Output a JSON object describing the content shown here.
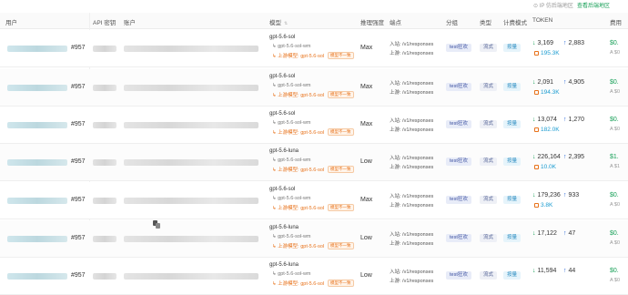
{
  "topbar": {
    "ip_text": "⊙ IP 仿后端地区",
    "link_text": "查看后端地区"
  },
  "headers": {
    "user": "用户",
    "api_key": "API 密钥",
    "account": "账户",
    "model": "模型",
    "reasoning": "推理强度",
    "endpoint": "端点",
    "group": "分组",
    "type": "类型",
    "billing": "计费模式",
    "token": "TOKEN",
    "cost": "费用"
  },
  "rows": [
    {
      "user_id": "#957",
      "model": "gpt-5.6-sol",
      "model_sub": "gpt-5.6-sol-wm",
      "upstream": "上游模型: gpt-5.6-sol",
      "tag": "模型不一致",
      "reasoning": "Max",
      "ep_in": "入站: /v1/responses",
      "ep_up": "上游: /v1/responses",
      "group": "test狂欢",
      "type": "流式",
      "billing": "按量",
      "tok_in": "3,169",
      "tok_out": "2,883",
      "cache": "195.3K",
      "cost": "$0.",
      "cost_sub": "A $0"
    },
    {
      "user_id": "#957",
      "model": "gpt-5.6-sol",
      "model_sub": "gpt-5.6-sol-wm",
      "upstream": "上游模型: gpt-5.6-sol",
      "tag": "模型不一致",
      "reasoning": "Max",
      "ep_in": "入站: /v1/responses",
      "ep_up": "上游: /v1/responses",
      "group": "test狂欢",
      "type": "流式",
      "billing": "按量",
      "tok_in": "2,091",
      "tok_out": "4,905",
      "cache": "194.3K",
      "cost": "$0.",
      "cost_sub": "A $0"
    },
    {
      "user_id": "#957",
      "model": "gpt-5.6-sol",
      "model_sub": "gpt-5.6-sol-wm",
      "upstream": "上游模型: gpt-5.6-sol",
      "tag": "模型不一致",
      "reasoning": "Max",
      "ep_in": "入站: /v1/responses",
      "ep_up": "上游: /v1/responses",
      "group": "test狂欢",
      "type": "流式",
      "billing": "按量",
      "tok_in": "13,074",
      "tok_out": "1,270",
      "cache": "182.0K",
      "cost": "$0.",
      "cost_sub": "A $0"
    },
    {
      "user_id": "#957",
      "model": "gpt-5.6-luna",
      "model_sub": "gpt-5.6-sol-wm",
      "upstream": "上游模型: gpt-5.6-sol",
      "tag": "模型不一致",
      "reasoning": "Low",
      "ep_in": "入站: /v1/responses",
      "ep_up": "上游: /v1/responses",
      "group": "test狂欢",
      "type": "流式",
      "billing": "按量",
      "tok_in": "226,164",
      "tok_out": "2,395",
      "cache": "10.0K",
      "cost": "$1.",
      "cost_sub": "A $1"
    },
    {
      "user_id": "#957",
      "model": "gpt-5.6-sol",
      "model_sub": "gpt-5.6-sol-wm",
      "upstream": "上游模型: gpt-5.6-sol",
      "tag": "模型不一致",
      "reasoning": "Max",
      "ep_in": "入站: /v1/responses",
      "ep_up": "上游: /v1/responses",
      "group": "test狂欢",
      "type": "流式",
      "billing": "按量",
      "tok_in": "179,236",
      "tok_out": "933",
      "cache": "3.8K",
      "cost": "$0.",
      "cost_sub": "A $0"
    },
    {
      "user_id": "#957",
      "model": "gpt-5.6-luna",
      "model_sub": "gpt-5.6-sol-wm",
      "upstream": "上游模型: gpt-5.6-sol",
      "tag": "模型不一致",
      "reasoning": "Low",
      "ep_in": "入站: /v1/responses",
      "ep_up": "上游: /v1/responses",
      "group": "test狂欢",
      "type": "流式",
      "billing": "按量",
      "tok_in": "17,122",
      "tok_out": "47",
      "cache": "",
      "cost": "$0.",
      "cost_sub": "A $0"
    },
    {
      "user_id": "#957",
      "model": "gpt-5.6-luna",
      "model_sub": "gpt-5.6-sol-wm",
      "upstream": "上游模型: gpt-5.6-sol",
      "tag": "模型不一致",
      "reasoning": "Low",
      "ep_in": "入站: /v1/responses",
      "ep_up": "上游: /v1/responses",
      "group": "test狂欢",
      "type": "流式",
      "billing": "按量",
      "tok_in": "11,594",
      "tok_out": "44",
      "cache": "",
      "cost": "$0.",
      "cost_sub": "A $0"
    }
  ]
}
